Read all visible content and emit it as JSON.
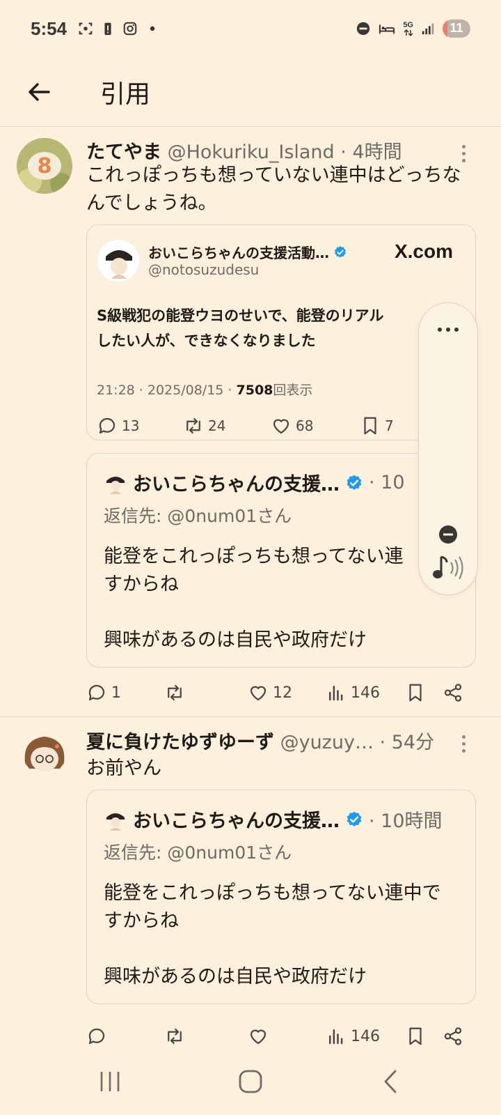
{
  "status_bar": {
    "time": "5:54",
    "network": "5G",
    "battery": "11",
    "battery_level": 0.11
  },
  "header": {
    "title": "引用"
  },
  "posts": [
    {
      "display_name": "たてやま",
      "handle": "@Hokuriku_Island",
      "time": "· 4時間",
      "body": "これっぽっちも想っていない連中はどっちなんでしょうね。",
      "embed": {
        "name": "おいこらちゃんの支援活動…",
        "handle": "@notosuzudesu",
        "source": "X.com",
        "text": "S級戦犯の能登ウヨのせいで、能登のリアル\nしたい人が、できなくなりました",
        "date": "21:28 · 2025/08/15 · ",
        "views_count": "7508",
        "views_label": "回表示",
        "replies": "13",
        "reposts": "24",
        "likes": "68",
        "bookmarks": "7"
      },
      "quote": {
        "name": "おいこらちゃんの支援…",
        "time": "· 10",
        "reply_to": "返信先: @0num01さん",
        "body": "能登をこれっぽっちも想ってない連\nすからね\n\n興味があるのは自民や政府だけ"
      },
      "actions": {
        "replies": "1",
        "reposts": "",
        "likes": "12",
        "views": "146"
      }
    },
    {
      "display_name": "夏に負けたゆずゆーず",
      "handle": "@yuzuy…",
      "time": "· 54分",
      "body": "お前やん",
      "quote": {
        "name": "おいこらちゃんの支援…",
        "time": "· 10時間",
        "reply_to": "返信先: @0num01さん",
        "body": "能登をこれっぽっちも想ってない連中で\nすからね\n\n興味があるのは自民や政府だけ"
      },
      "actions": {
        "replies": "",
        "reposts": "",
        "likes": "",
        "views": "146"
      }
    }
  ],
  "colors": {
    "background": "#fdf1dd",
    "verified": "#1d9bf0",
    "text": "#1f1a16",
    "muted": "#6e6a66"
  }
}
